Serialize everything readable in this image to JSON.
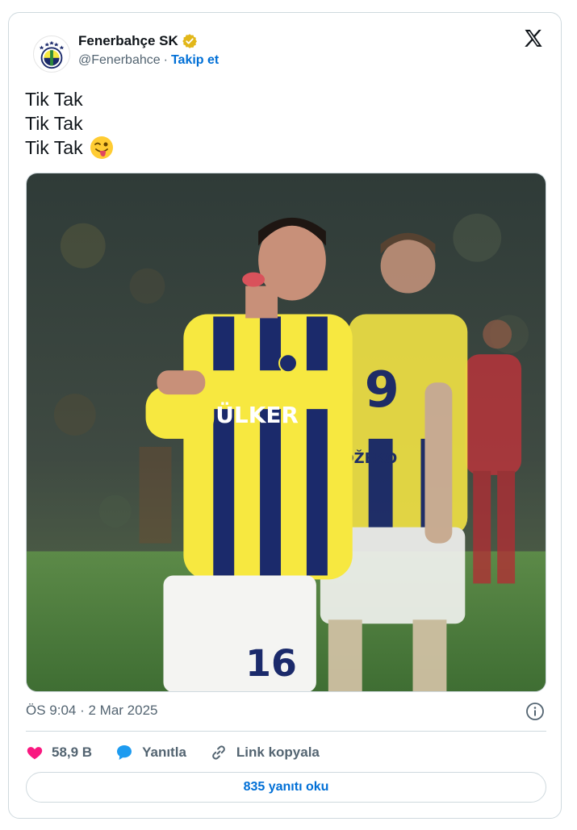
{
  "author": {
    "display_name": "Fenerbahçe SK",
    "handle": "@Fenerbahce",
    "separator": "·",
    "follow_label": "Takip et",
    "verified_color": "#e2b719"
  },
  "tweet": {
    "lines": [
      "Tik Tak",
      "Tik Tak",
      "Tik Tak"
    ],
    "emoji": "winking-face-with-tongue"
  },
  "photo": {
    "player_front_number": "16",
    "player_back_number": "9",
    "player_back_name": "DŽEKO",
    "sponsor_text": "ÜLKER"
  },
  "timestamp": "ÖS 9:04 · 2 Mar 2025",
  "actions": {
    "likes": "58,9 B",
    "reply_label": "Yanıtla",
    "copy_link_label": "Link kopyala"
  },
  "replies_button": "835 yanıtı oku",
  "colors": {
    "accent": "#006fd6",
    "like": "#f91880",
    "jersey_yellow": "#f7e840",
    "jersey_navy": "#1b2a6b"
  }
}
